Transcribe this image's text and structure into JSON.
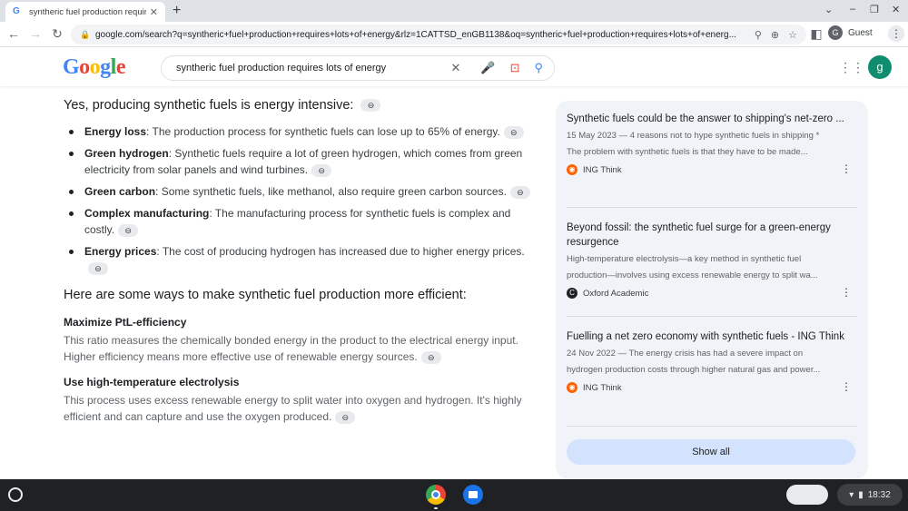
{
  "browser": {
    "tab": {
      "favicon": "G",
      "title": "syntheric fuel production require",
      "close": "✕"
    },
    "new_tab": "+",
    "window_controls": [
      "⌄",
      "–",
      "❐",
      "✕"
    ],
    "nav": {
      "back": "←",
      "forward": "→",
      "reload": "↻"
    },
    "url": "google.com/search?q=syntheric+fuel+production+requires+lots+of+energy&rlz=1CATTSD_enGB1138&oq=syntheric+fuel+production+requires+lots+of+energ...",
    "profile": {
      "initial": "G",
      "label": "Guest"
    },
    "menu": "⋮"
  },
  "google": {
    "logo": "Google",
    "logo_colors": [
      "#4285f4",
      "#ea4335",
      "#fbbc05",
      "#4285f4",
      "#34a853",
      "#ea4335"
    ],
    "query": "syntheric fuel production requires lots of energy",
    "account_initial": "g"
  },
  "answer": {
    "intro": "Yes, producing synthetic fuels is energy intensive:",
    "points": [
      {
        "term": "Energy loss",
        "text": ": The production process for synthetic fuels can lose up to 65% of energy."
      },
      {
        "term": "Green hydrogen",
        "text": ": Synthetic fuels require a lot of green hydrogen, which comes from green electricity from solar panels and wind turbines."
      },
      {
        "term": "Green carbon",
        "text": ": Some synthetic fuels, like methanol, also require green carbon sources."
      },
      {
        "term": "Complex manufacturing",
        "text": ": The manufacturing process for synthetic fuels is complex and costly."
      },
      {
        "term": "Energy prices",
        "text": ": The cost of producing hydrogen has increased due to higher energy prices."
      }
    ],
    "efficiency_heading": "Here are some ways to make synthetic fuel production more efficient:",
    "sections": [
      {
        "title": "Maximize PtL-efficiency",
        "body": "This ratio measures the chemically bonded energy in the product to the electrical energy input. Higher efficiency means more effective use of renewable energy sources."
      },
      {
        "title": "Use high-temperature electrolysis",
        "body": "This process uses excess renewable energy to split water into oxygen and hydrogen. It's highly efficient and can capture and use the oxygen produced."
      }
    ]
  },
  "sources": {
    "cards": [
      {
        "title": "Synthetic fuels could be the answer to shipping's net-zero ...",
        "line1": "15 May 2023 — 4 reasons not to hype synthetic fuels in shipping *",
        "line2": "The problem with synthetic fuels is that they have to be made...",
        "source": "ING Think",
        "source_color": "#ff6200"
      },
      {
        "title": "Beyond fossil: the synthetic fuel surge for a green-energy resurgence",
        "line1": "High-temperature electrolysis—a key method in synthetic fuel",
        "line2": "production—involves using excess renewable energy to split wa...",
        "source": "Oxford Academic",
        "source_color": "#202124"
      },
      {
        "title": "Fuelling a net zero economy with synthetic fuels - ING Think",
        "line1": "24 Nov 2022 — The energy crisis has had a severe impact on",
        "line2": "hydrogen production costs through higher natural gas and power...",
        "source": "ING Think",
        "source_color": "#ff6200"
      }
    ],
    "show_all": "Show all"
  },
  "shelf": {
    "time": "18:32"
  }
}
